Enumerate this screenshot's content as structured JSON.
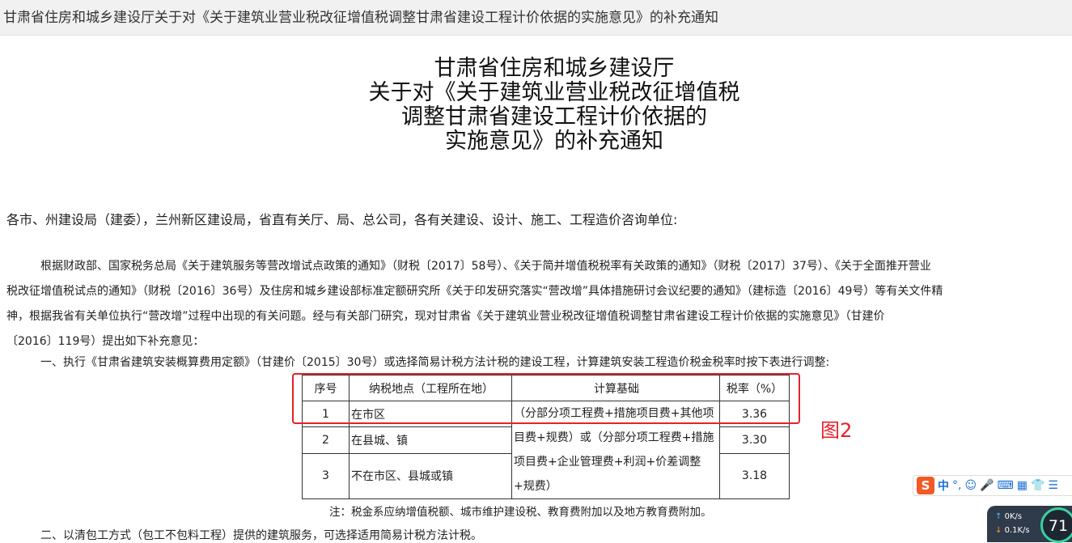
{
  "window": {
    "title": "甘肃省住房和城乡建设厅关于对《关于建筑业营业税改征增值税调整甘肃省建设工程计价依据的实施意见》的补充通知"
  },
  "document": {
    "title_lines": [
      "甘肃省住房和城乡建设厅",
      "关于对《关于建筑业营业税改征增值税",
      "调整甘肃省建设工程计价依据的",
      "实施意见》的补充通知"
    ],
    "recipients": "各市、州建设局（建委），兰州新区建设局，省直有关厅、局、总公司，各有关建设、设计、施工、工程造价咨询单位:",
    "paragraph1_lines": [
      "根据财政部、国家税务总局《关于建筑服务等营改增试点政策的通知》（财税〔2017〕58号）、《关于简并增值税税率有关政策的通知》（财税〔2017〕37号）、《关于全面推开营业",
      "税改征增值税试点的通知》（财税〔2016〕36号）及住房和城乡建设部标准定额研究所《关于印发研究落实“营改增”具体措施研讨会议纪要的通知》（建标造〔2016〕49号）等有关文件精",
      "神，根据我省有关单位执行“营改增”过程中出现的有关问题。经与有关部门研究，现对甘肃省《关于建筑业营业税改征增值税调整甘肃省建设工程计价依据的实施意见》（甘建价",
      "〔2016〕119号）提出如下补充意见："
    ],
    "section1": "一、执行《甘肃省建筑安装概算费用定额》（甘建价〔2015〕30号）或选择简易计税方法计税的建设工程，计算建筑安装工程造价税金税率时按下表进行调整:",
    "table": {
      "headers": [
        "序号",
        "纳税地点（工程所在地）",
        "计算基础",
        "税率（%）"
      ],
      "rows": [
        {
          "no": "1",
          "place": "在市区",
          "rate": "3.36"
        },
        {
          "no": "2",
          "place": "在县城、镇",
          "rate": "3.30"
        },
        {
          "no": "3",
          "place": "不在市区、县城或镇",
          "rate": "3.18"
        }
      ],
      "base": "（分部分项工程费+措施项目费+其他项目费+规费）或（分部分项工程费+措施项目费+企业管理费+利润+价差调整+规费）"
    },
    "note": "注：税金系应纳增值税额、城市维护建设税、教育费附加以及地方教育费附加。",
    "section2": "二、以清包工方式（包工不包料工程）提供的建筑服务，可选择适用简易计税方法计税。"
  },
  "annotation": {
    "label": "图2",
    "color": "#e8202a"
  },
  "ime_toolbar": {
    "logo": "S",
    "mode": "中"
  },
  "net_monitor": {
    "upload": "0K/s",
    "download": "0.1K/s",
    "gauge": "71"
  }
}
